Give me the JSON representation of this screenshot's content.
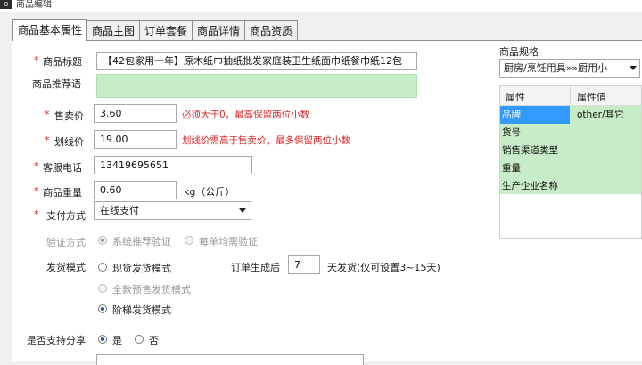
{
  "window": {
    "title": "商品编辑",
    "app_icon": "8"
  },
  "tabs": [
    {
      "label": "商品基本属性",
      "active": true
    },
    {
      "label": "商品主图",
      "active": false
    },
    {
      "label": "订单套餐",
      "active": false
    },
    {
      "label": "商品详情",
      "active": false
    },
    {
      "label": "商品资质",
      "active": false
    }
  ],
  "form": {
    "title": {
      "label": "商品标题",
      "value": "【42包家用一年】原木纸巾抽纸批发家庭装卫生纸面巾纸餐巾纸12包"
    },
    "recommend": {
      "label": "商品推荐语",
      "value": ""
    },
    "price": {
      "label": "售卖价",
      "value": "3.60",
      "hint": "必须大于0，最高保留两位小数"
    },
    "strike_price": {
      "label": "划线价",
      "value": "19.00",
      "hint": "划线价需高于售卖价，最多保留两位小数"
    },
    "service_phone": {
      "label": "客服电话",
      "value": "13419695651"
    },
    "weight": {
      "label": "商品重量",
      "value": "0.60",
      "unit": "kg（公斤）"
    },
    "payment": {
      "label": "支付方式",
      "selected": "在线支付"
    },
    "verify": {
      "label": "验证方式",
      "opt1": "系统推荐验证",
      "opt2": "每单均需验证"
    },
    "shipping": {
      "label": "发货模式",
      "opt1": "现货发货模式",
      "opt2": "全款预售发货模式",
      "opt3": "阶梯发货模式",
      "after_label": "订单生成后",
      "days": "7",
      "days_hint": "天发货(仅可设置3~15天)"
    },
    "share": {
      "label": "是否支持分享",
      "yes": "是",
      "no": "否"
    }
  },
  "spec": {
    "label": "商品规格",
    "category": "厨房/烹饪用具»»厨用小",
    "col_attr": "属性",
    "col_value": "属性值",
    "rows": [
      {
        "key": "品牌",
        "value": "other/其它"
      },
      {
        "key": "货号",
        "value": ""
      },
      {
        "key": "销售渠道类型",
        "value": ""
      },
      {
        "key": "重量",
        "value": ""
      },
      {
        "key": "生产企业名称",
        "value": ""
      }
    ]
  },
  "colors": {
    "green_field": "#c8ecc8",
    "hint_red": "#d22222",
    "selected_blue": "#3399ff"
  }
}
